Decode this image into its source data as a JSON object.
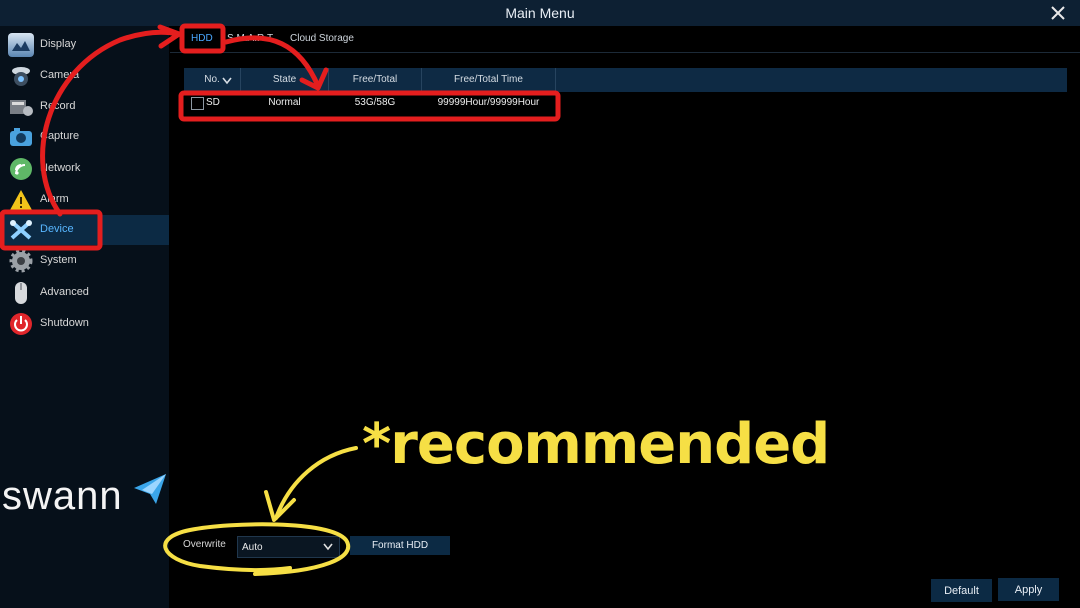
{
  "window": {
    "title": "Main Menu"
  },
  "sidebar": {
    "items": [
      {
        "label": "Display",
        "icon": "display-icon"
      },
      {
        "label": "Camera",
        "icon": "camera-icon"
      },
      {
        "label": "Record",
        "icon": "record-icon"
      },
      {
        "label": "Capture",
        "icon": "capture-icon"
      },
      {
        "label": "Network",
        "icon": "network-icon"
      },
      {
        "label": "Alarm",
        "icon": "alarm-icon"
      },
      {
        "label": "Device",
        "icon": "device-icon",
        "active": true
      },
      {
        "label": "System",
        "icon": "gear-icon"
      },
      {
        "label": "Advanced",
        "icon": "mouse-icon"
      },
      {
        "label": "Shutdown",
        "icon": "power-icon"
      }
    ],
    "logo": "swann"
  },
  "tabs": [
    {
      "label": "HDD",
      "active": true
    },
    {
      "label": "S.M.A.R.T"
    },
    {
      "label": "Cloud Storage"
    }
  ],
  "table": {
    "columns": [
      "No.",
      "State",
      "Free/Total",
      "Free/Total Time"
    ],
    "rows": [
      {
        "no": "SD",
        "state": "Normal",
        "free_total": "53G/58G",
        "free_total_time": "99999Hour/99999Hour"
      }
    ]
  },
  "footer": {
    "overwrite_label": "Overwrite",
    "overwrite_value": "Auto",
    "format_button": "Format HDD",
    "default_button": "Default",
    "apply_button": "Apply"
  },
  "annotation": {
    "text": "*recommended"
  },
  "colors": {
    "accent": "#4aa8ff",
    "highlight_red": "#e41e1e",
    "note_yellow": "#f6df45",
    "panel_dark_blue": "#0c2a44"
  }
}
